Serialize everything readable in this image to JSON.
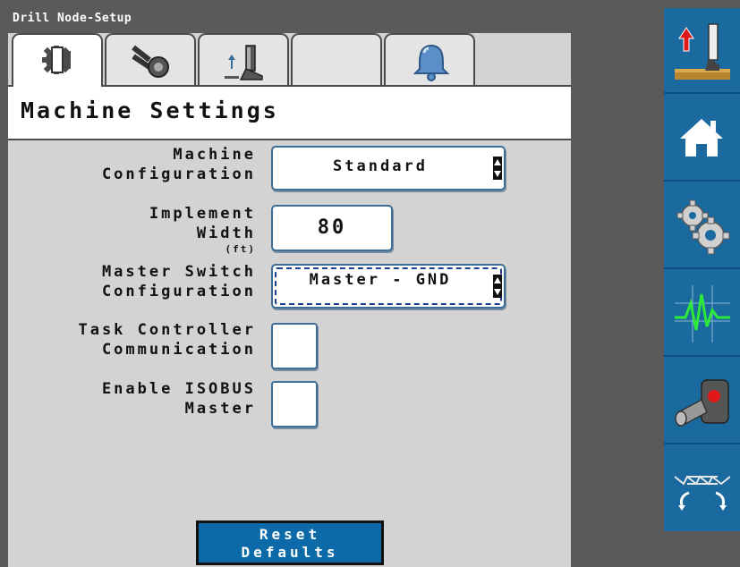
{
  "window": {
    "title": "Drill Node-Setup"
  },
  "tabs": [
    {
      "icon": "gear-bracket-icon",
      "active": true
    },
    {
      "icon": "gauge-wheel-icon",
      "active": false
    },
    {
      "icon": "opener-lift-icon",
      "active": false
    },
    {
      "icon": "",
      "active": false
    },
    {
      "icon": "bell-icon",
      "active": false
    }
  ],
  "page": {
    "title": "Machine Settings"
  },
  "settings": {
    "machine_configuration": {
      "label": "Machine\nConfiguration",
      "value": "Standard"
    },
    "implement_width": {
      "label": "Implement\nWidth",
      "unit": "(ft)",
      "value": "80"
    },
    "master_switch_configuration": {
      "label": "Master Switch\nConfiguration",
      "value": "Master - GND"
    },
    "task_controller_communication": {
      "label": "Task Controller\nCommunication",
      "checked": false
    },
    "enable_isobus_master": {
      "label": "Enable ISOBUS\nMaster",
      "checked": false
    }
  },
  "reset_button": {
    "line1": "Reset",
    "line2": "Defaults"
  },
  "right_toolbar": [
    {
      "icon": "raise-implement-icon"
    },
    {
      "icon": "home-icon"
    },
    {
      "icon": "settings-gears-icon"
    },
    {
      "icon": "diagnostics-pulse-icon"
    },
    {
      "icon": "joystick-icon"
    },
    {
      "icon": "fold-implement-icon"
    }
  ],
  "colors": {
    "accent": "#1a6aa0",
    "button": "#0d6aa8",
    "field_border": "#3d6d99",
    "panel": "#d3d3d3"
  }
}
